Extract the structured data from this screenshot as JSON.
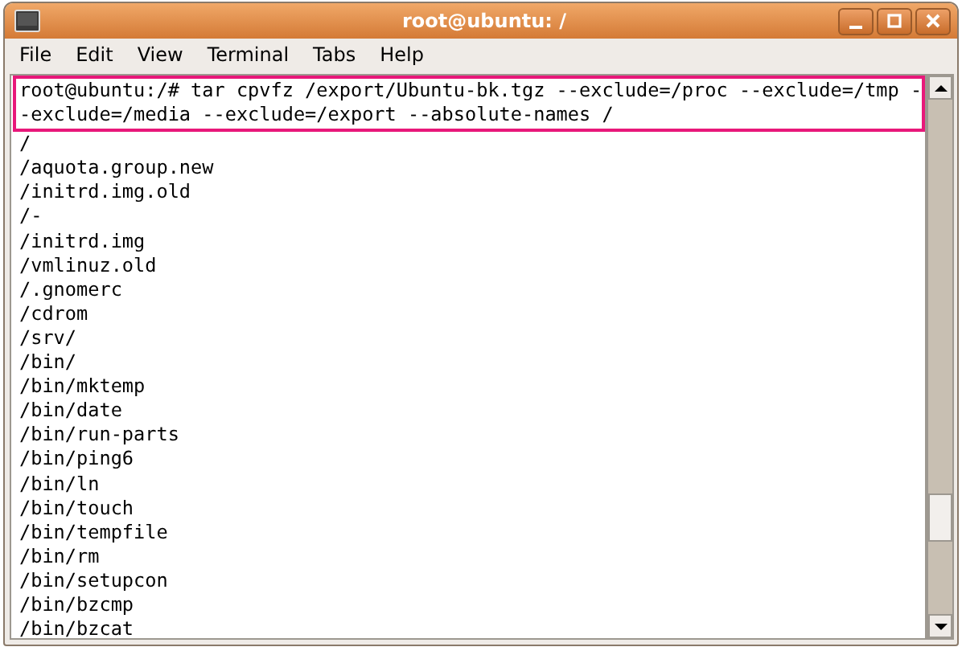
{
  "window": {
    "title": "root@ubuntu: /"
  },
  "menu": [
    "File",
    "Edit",
    "View",
    "Terminal",
    "Tabs",
    "Help"
  ],
  "terminal": {
    "command_lines": [
      "root@ubuntu:/# tar cpvfz /export/Ubuntu-bk.tgz --exclude=/proc --exclude=/tmp -",
      "-exclude=/media --exclude=/export --absolute-names /"
    ],
    "output_lines": [
      "/",
      "/aquota.group.new",
      "/initrd.img.old",
      "/-",
      "/initrd.img",
      "/vmlinuz.old",
      "/.gnomerc",
      "/cdrom",
      "/srv/",
      "/bin/",
      "/bin/mktemp",
      "/bin/date",
      "/bin/run-parts",
      "/bin/ping6",
      "/bin/ln",
      "/bin/touch",
      "/bin/tempfile",
      "/bin/rm",
      "/bin/setupcon",
      "/bin/bzcmp",
      "/bin/bzcat"
    ]
  }
}
